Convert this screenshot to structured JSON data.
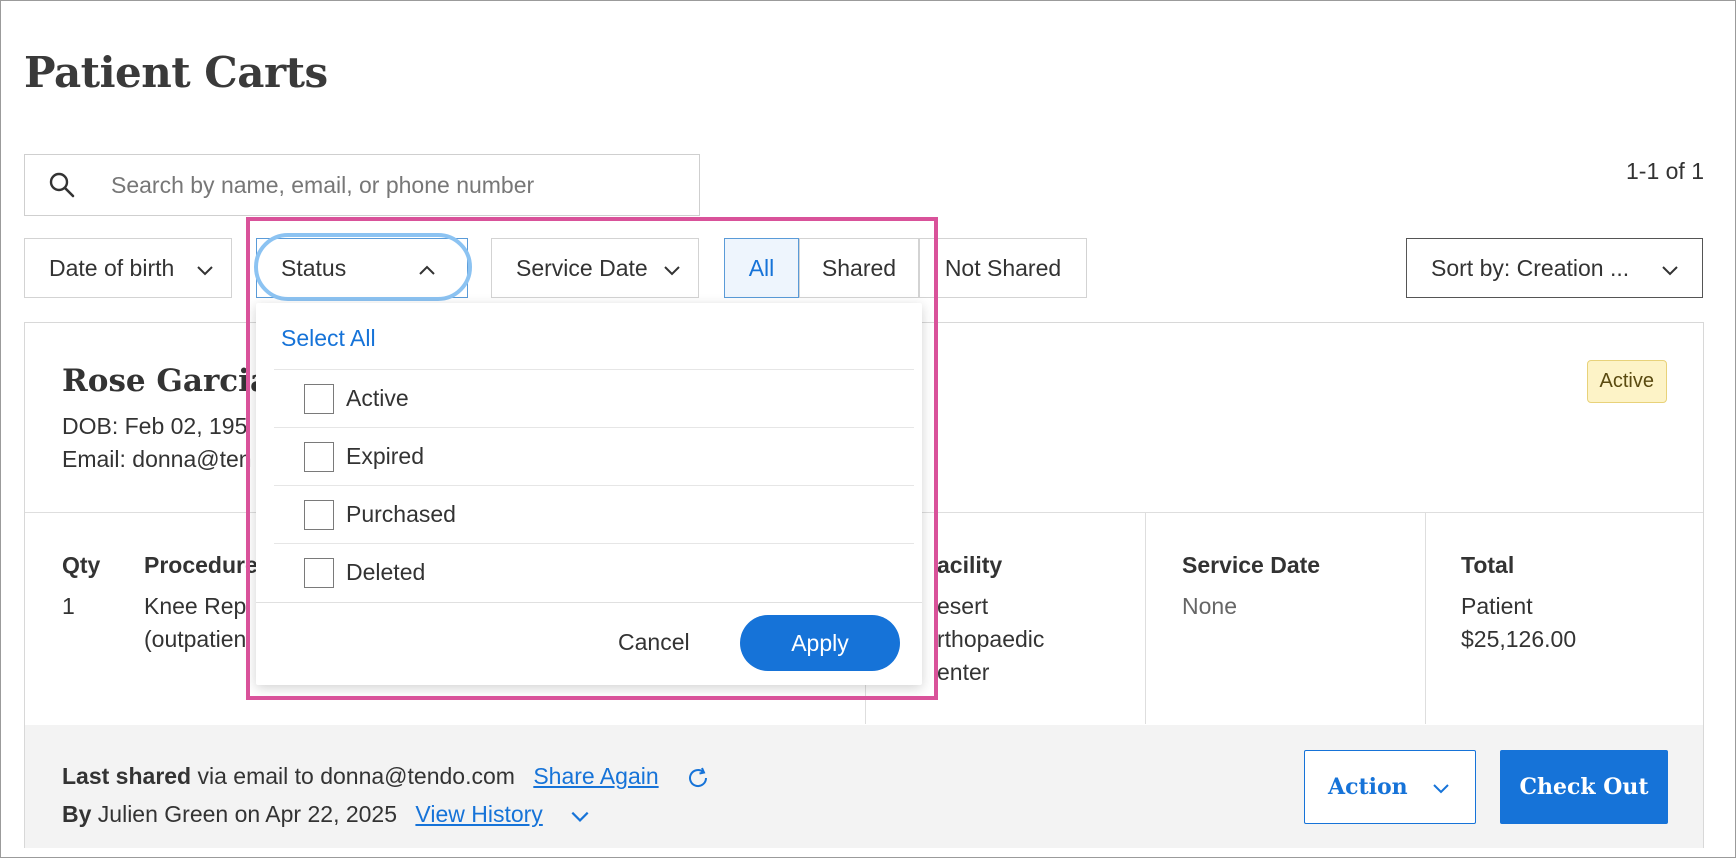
{
  "page": {
    "title": "Patient Carts"
  },
  "search": {
    "placeholder": "Search by name, email, or phone number"
  },
  "pager": {
    "text": "1-1 of 1"
  },
  "filters": {
    "date_of_birth": "Date of birth",
    "status": "Status",
    "service_date": "Service Date"
  },
  "share_toggle": {
    "all": "All",
    "shared": "Shared",
    "not_shared": "Not Shared",
    "selected": "All"
  },
  "sort": {
    "label": "Sort by: Creation ..."
  },
  "status_dropdown": {
    "select_all": "Select All",
    "options": [
      {
        "label": "Active",
        "checked": false
      },
      {
        "label": "Expired",
        "checked": false
      },
      {
        "label": "Purchased",
        "checked": false
      },
      {
        "label": "Deleted",
        "checked": false
      }
    ],
    "cancel": "Cancel",
    "apply": "Apply"
  },
  "cart": {
    "patient_name": "Rose Garcia",
    "dob_line": "DOB: Feb 02, 195",
    "email_line": "Email: donna@ten",
    "status_badge": "Active",
    "columns": {
      "qty": "Qty",
      "procedure": "Procedure",
      "facility": "acility",
      "service_date": "Service Date",
      "total": "Total"
    },
    "row": {
      "qty": "1",
      "procedure_1": "Knee Repl",
      "procedure_2": "(outpatien",
      "facility_1": "esert",
      "facility_2": "rthopaedic",
      "facility_3": "enter",
      "service_date": "None",
      "total_label": "Patient",
      "total_value": "$25,126.00"
    },
    "footer": {
      "last_shared_bold": "Last shared",
      "last_shared_rest": " via email to donna@tendo.com",
      "share_again": "Share Again",
      "by_bold": "By",
      "by_rest": " Julien Green on Apr 22, 2025",
      "view_history": "View History",
      "action": "Action",
      "checkout": "Check Out"
    }
  },
  "colors": {
    "accent": "#1673d8",
    "highlight": "#d9529a",
    "badge_bg": "#fdf3c7"
  }
}
